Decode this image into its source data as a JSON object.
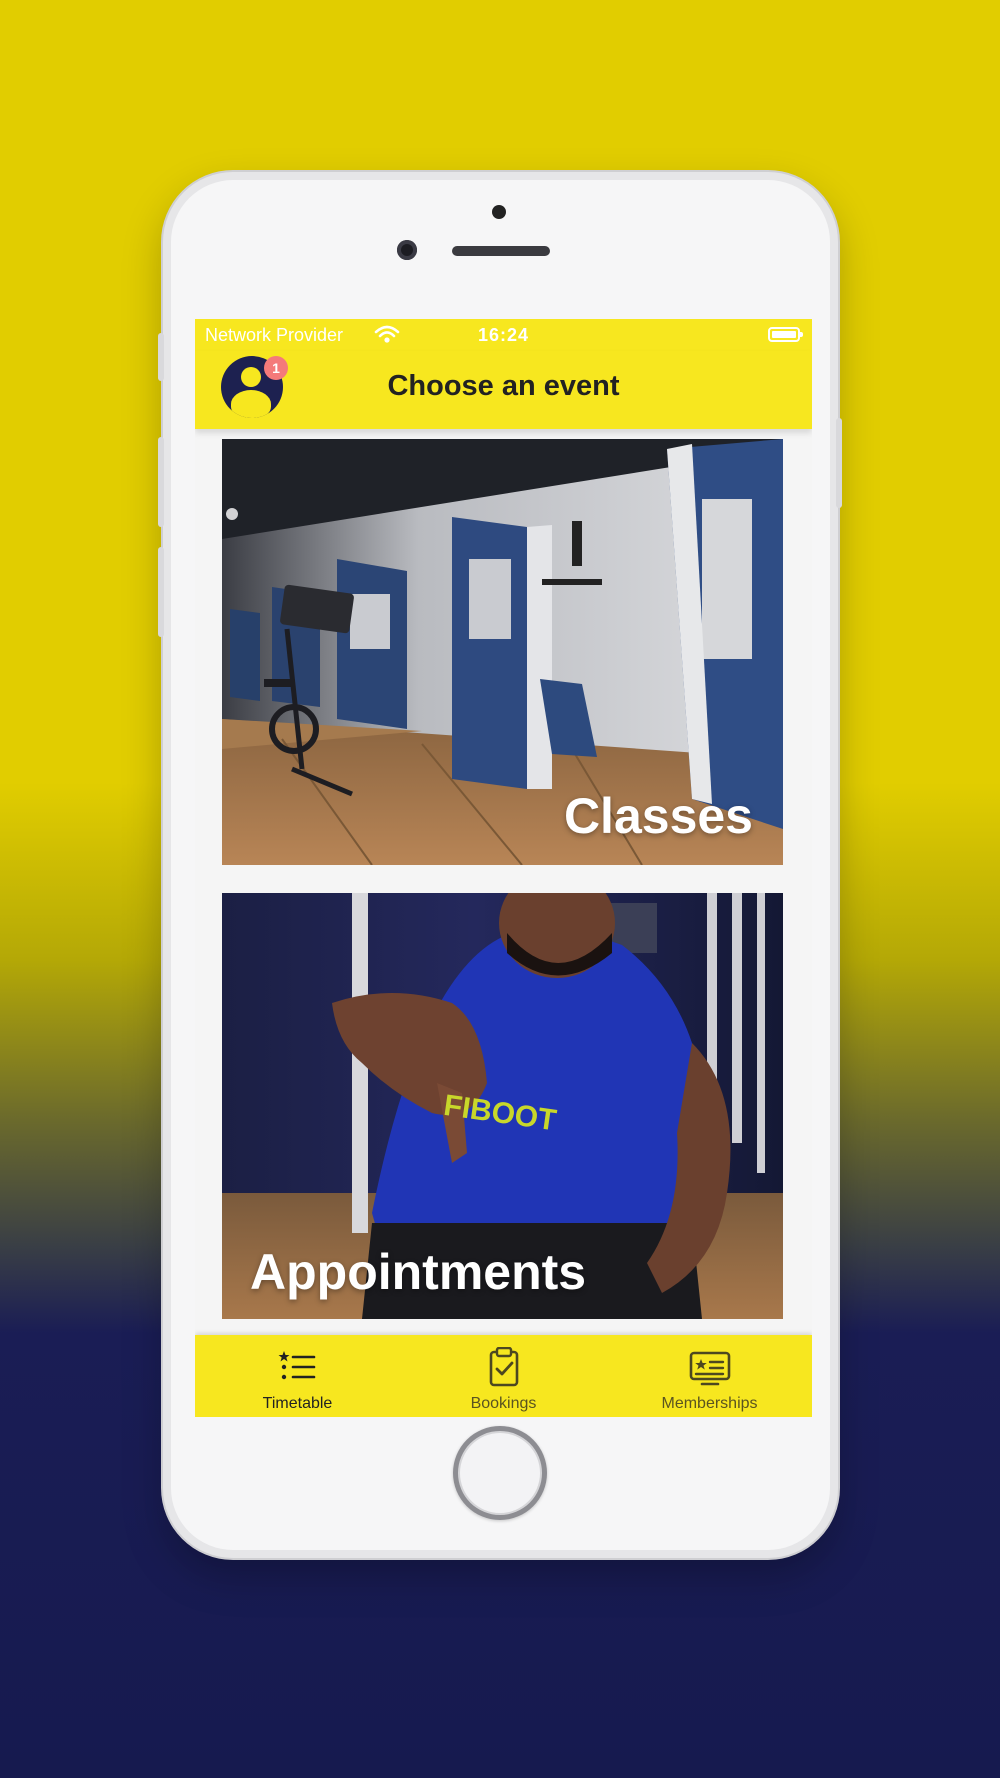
{
  "statusbar": {
    "carrier": "Network Provider",
    "time": "16:24"
  },
  "header": {
    "title": "Choose an event",
    "notification_count": "1"
  },
  "cards": [
    {
      "label": "Classes"
    },
    {
      "label": "Appointments"
    }
  ],
  "tabs": [
    {
      "label": "Timetable",
      "icon": "list-icon"
    },
    {
      "label": "Bookings",
      "icon": "clipboard-check-icon"
    },
    {
      "label": "Memberships",
      "icon": "id-card-icon"
    }
  ],
  "colors": {
    "accent": "#f7e71f",
    "navy": "#1d2150",
    "badge": "#f47a7a"
  }
}
